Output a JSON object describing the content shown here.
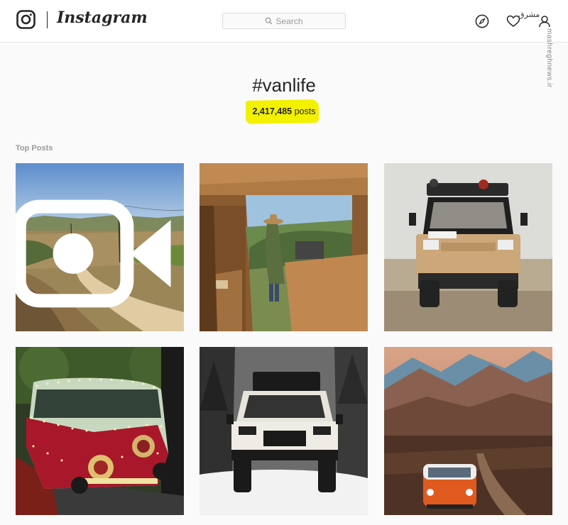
{
  "header": {
    "brand": "Instagram",
    "search_placeholder": "Search",
    "watermark": "مشرق",
    "watermark_url": "mashreghnews.ir"
  },
  "hashtag": {
    "title": "#vanlife",
    "post_count": "2,417,485",
    "post_suffix": "posts"
  },
  "top_posts_label": "Top Posts",
  "posts": [
    {
      "scene": "dirt-road-hills",
      "is_video": true
    },
    {
      "scene": "van-interior-woman",
      "is_video": false
    },
    {
      "scene": "vw-camper-desert",
      "is_video": false
    },
    {
      "scene": "vw-bus-christmas-lights",
      "is_video": false
    },
    {
      "scene": "truck-snow-forest",
      "is_video": false
    },
    {
      "scene": "orange-vw-mountains",
      "is_video": false
    }
  ],
  "colors": {
    "highlight": "#f3f100",
    "text": "#262626",
    "muted": "#999999",
    "border": "#dbdbdb"
  }
}
